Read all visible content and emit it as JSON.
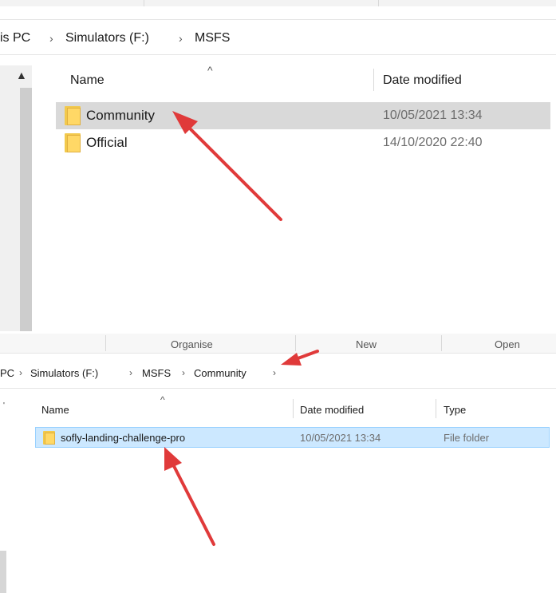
{
  "top_window": {
    "breadcrumb": [
      "is PC",
      "Simulators (F:)",
      "MSFS"
    ],
    "column_headers": {
      "name": "Name",
      "date_modified": "Date modified"
    },
    "rows": [
      {
        "name": "Community",
        "date": "10/05/2021 13:34",
        "selected": true
      },
      {
        "name": "Official",
        "date": "14/10/2020 22:40",
        "selected": false
      }
    ]
  },
  "bottom_window": {
    "ribbon_groups": [
      "Organise",
      "New",
      "Open"
    ],
    "breadcrumb": [
      "PC",
      "Simulators (F:)",
      "MSFS",
      "Community"
    ],
    "column_headers": {
      "name": "Name",
      "date_modified": "Date modified",
      "type": "Type"
    },
    "rows": [
      {
        "name": "sofly-landing-challenge-pro",
        "date": "10/05/2021 13:34",
        "type": "File folder",
        "selected": true
      }
    ]
  },
  "colors": {
    "annotation_arrow": "#e03a3a",
    "selected_gray": "#d9d9d9",
    "selected_blue": "#cce8ff",
    "folder_yellow": "#ffd866"
  }
}
